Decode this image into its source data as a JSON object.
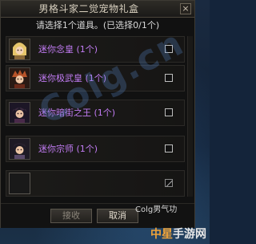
{
  "dialog": {
    "title": "男格斗家二觉宠物礼盒",
    "close_glyph": "×",
    "instruction": "请选择1个道具。(已选择0/1个)"
  },
  "items": [
    {
      "label": "迷你念皇 (1个)",
      "icon": "avatar-nen-master-icon",
      "checked": false
    },
    {
      "label": "迷你极武皇 (1个)",
      "icon": "avatar-striker-icon",
      "checked": false
    },
    {
      "label": "迷你暗街之王 (1个)",
      "icon": "avatar-brawler-icon",
      "checked": false
    },
    {
      "label": "迷你宗师 (1个)",
      "icon": "avatar-grappler-icon",
      "checked": false
    }
  ],
  "buttons": {
    "accept": "接收",
    "cancel": "取消"
  },
  "overlay": {
    "watermark": "Colg.cn",
    "corner_label": "Colg男气功",
    "brand_part1": "中星",
    "brand_part2": "手游网"
  },
  "colors": {
    "item_label": "#c27cf4",
    "panel_bg": "#111111",
    "title_text": "#d8d0bf"
  }
}
